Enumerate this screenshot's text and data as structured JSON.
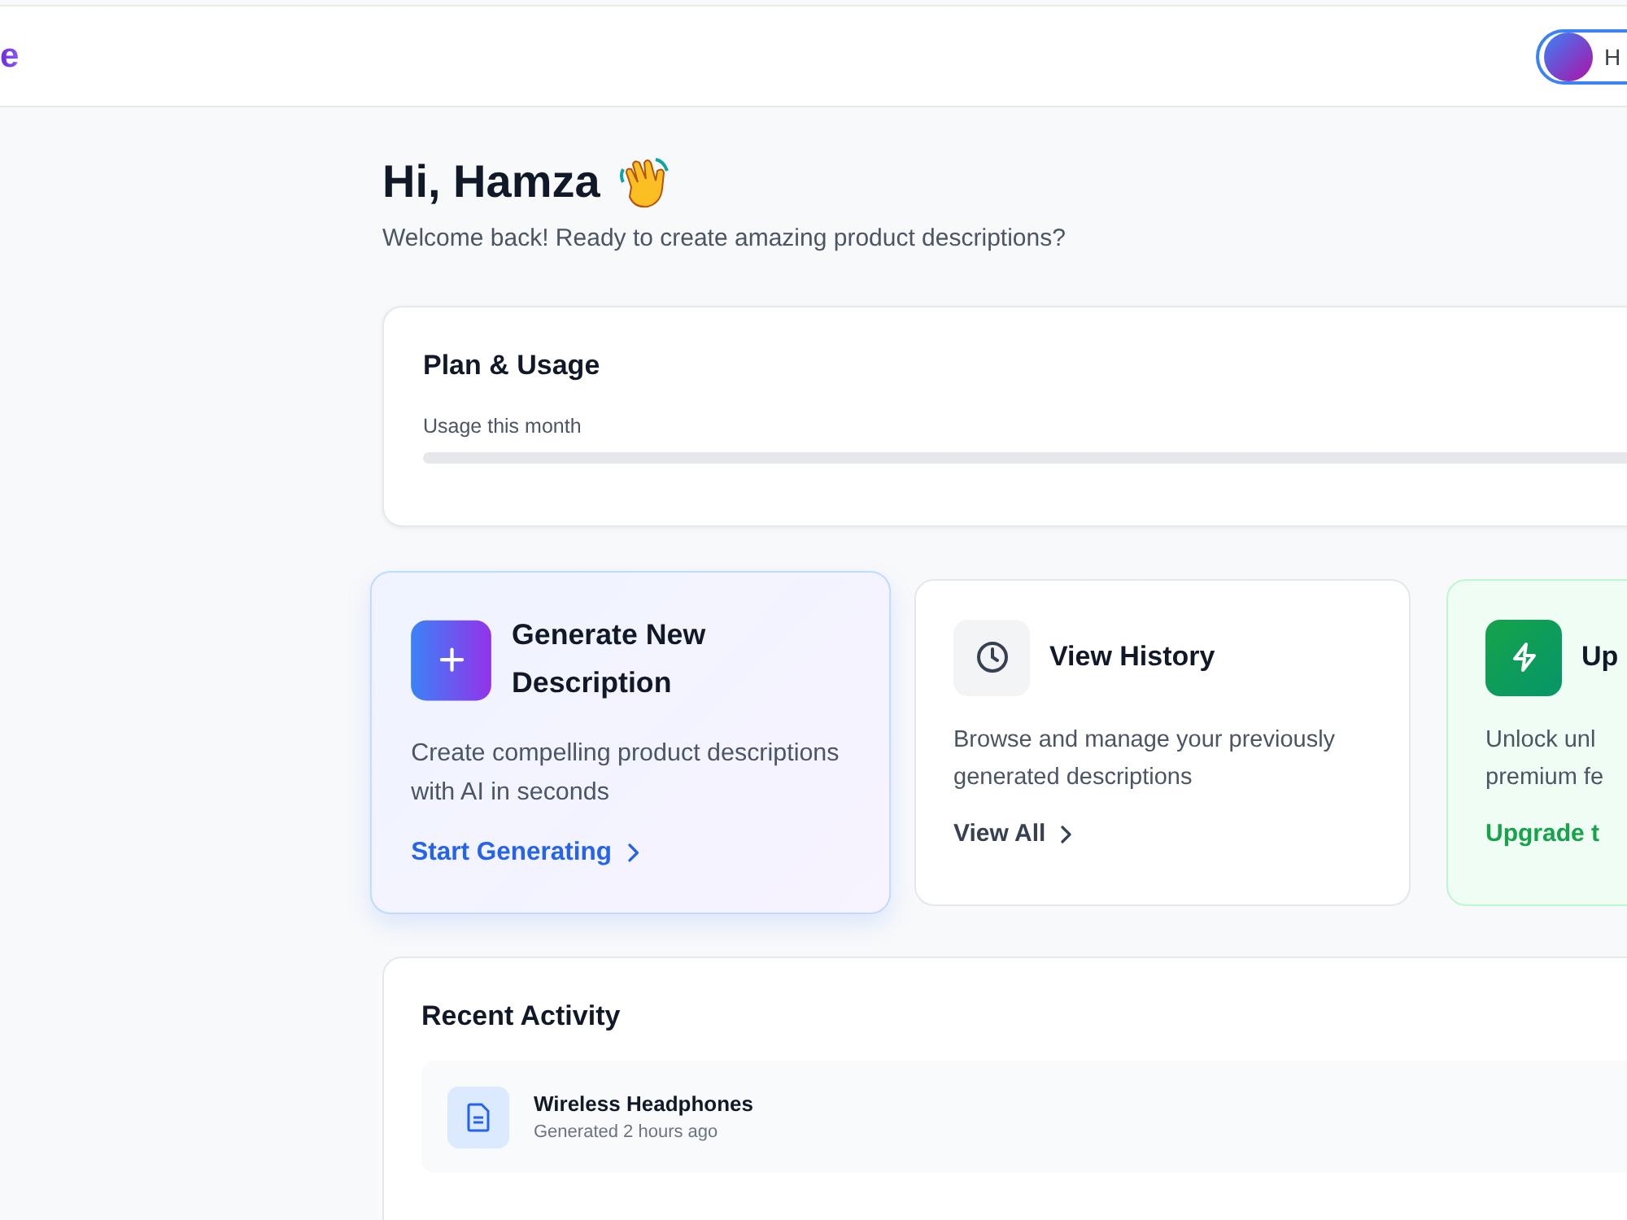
{
  "header": {
    "logo": "e",
    "user": {
      "name": "H"
    }
  },
  "greeting": {
    "title": "Hi, Hamza",
    "subtitle": "Welcome back! Ready to create amazing product descriptions?"
  },
  "plan": {
    "title": "Plan & Usage",
    "usage_label": "Usage this month",
    "level": 0
  },
  "actions": [
    {
      "kind": "generate",
      "title": "Generate New Description",
      "description": "Create compelling product descriptions with AI in seconds",
      "link": "Start Generating"
    },
    {
      "kind": "history",
      "title": "View History",
      "description": "Browse and manage your previously generated descriptions",
      "link": "View All"
    },
    {
      "kind": "upgrade",
      "title": "Up",
      "description": "Unlock unl premium fe",
      "link": "Upgrade t"
    }
  ],
  "recent_activity": {
    "title": "Recent Activity",
    "items": [
      {
        "title": "Wireless Headphones",
        "meta": "Generated 2 hours ago"
      }
    ]
  }
}
